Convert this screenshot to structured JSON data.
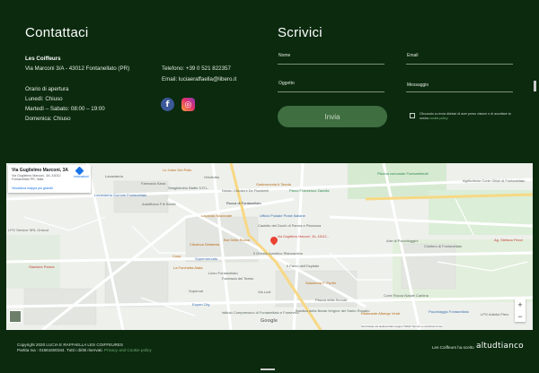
{
  "contact": {
    "title": "Contattaci",
    "business_name": "Les Coiffeurs",
    "address": "Via Marconi 3/A - 43012 Fontanellato (PR)",
    "phone": "Telefono: +39 0 521 822357",
    "email": "Email: luciaeraffaella@libero.it",
    "hours_title": "Orario di apertura",
    "hours": [
      "Lunedì: Chiuso",
      "Martedì – Sabato: 08:00 – 19:00",
      "Domenica: Chiuso"
    ],
    "social": [
      {
        "name": "facebook",
        "icon": "facebook-icon",
        "glyph": "f",
        "color": "#3b5998"
      },
      {
        "name": "instagram",
        "icon": "instagram-icon",
        "glyph": "◎",
        "color": "#e1306c"
      }
    ]
  },
  "form": {
    "title": "Scrivici",
    "fields": {
      "name": {
        "label": "Nome",
        "value": ""
      },
      "email": {
        "label": "Email",
        "value": ""
      },
      "subject": {
        "label": "Oggetto",
        "value": ""
      },
      "message": {
        "label": "Messaggio",
        "value": ""
      }
    },
    "submit_label": "Invia",
    "consent_text": "Cliccando su invia dichiari di aver preso visione e di accettare la nostra",
    "consent_link": "cookie policy"
  },
  "map": {
    "card": {
      "title": "Via Guglielmo Marconi, 3A",
      "address": "Via Guglielmo Marconi, 3A, 43012 Fontanellato PR, Italia",
      "view_larger": "Visualizza mappa più grande",
      "directions": "Indicazioni"
    },
    "pin_label": "Via Guglielmo Marconi, 3A, 43012...",
    "places": [
      "Le Joker Del Pollo",
      "Lavanderia",
      "Ortofrutta",
      "Lavanderia Gomme Fontanellato",
      "Farmacia Sana",
      "Autofficina F.lli Sciotti",
      "Sbagliatoblu Biaffo S.R.L.",
      "Gastronomia A Tavola",
      "Parco Francesco Zanella",
      "Notaio Giovanni De Fischietti",
      "Rocca di Fontanellato",
      "Locanda Nazionale",
      "Ufficio Postale Poste Italiane",
      "Castello dei Duchi di Parma e Piacenza",
      "Bar Della Rocca",
      "Piscina comunale Fontanebleali",
      "Agriturismo Corte Gilioli di Fontanellato",
      "Arte di Pacchioggini",
      "Cimitero di Fontanellato",
      "Ag. Stefano Pecci",
      "Ciboteca Gelateria",
      "Il Ghiotto Aperitivo Ristorantino",
      "Supermercato",
      "Coop",
      "La Forchetta Alata",
      "Il Parco dell'Ospitale",
      "Liceo Fontanellato",
      "Farmacia del Teatro",
      "Salumeria F. Porfiri",
      "Via Ludi",
      "Expert City",
      "Istituto Comprensivo di Fontanellato e Fontevivo",
      "Basilica della Beata Vergine del Santo Rosario",
      "Ristorante Albergo Verdi",
      "Piazza della Scuola",
      "Pacchiaggio Fontanellato",
      "Corte Rocca Natale Cantina",
      "LPG Adinfol Pierc",
      "Stazione Parma",
      "Supercat",
      "LPG Service SRL Ortocol"
    ],
    "google_logo": "Google",
    "attribution": "Scorciatoie da tastiera   Dati mappa ©2022   Termini e condizioni d'uso"
  },
  "footer": {
    "copyright": "Copyright 2020 LUCIA E RAFFAELLA LES COIFFEURES",
    "vat": "Partita Iva : 01661600344. Tutti i diritti riservati.",
    "privacy_link": "Privacy and Cookie policy",
    "credit_prefix": "Les Coiffeurs ha scelto",
    "credit_brand": "altudtianco"
  },
  "colors": {
    "background": "#0b2a0e",
    "button": "#3f6e41",
    "map_pin": "#ea4335"
  }
}
